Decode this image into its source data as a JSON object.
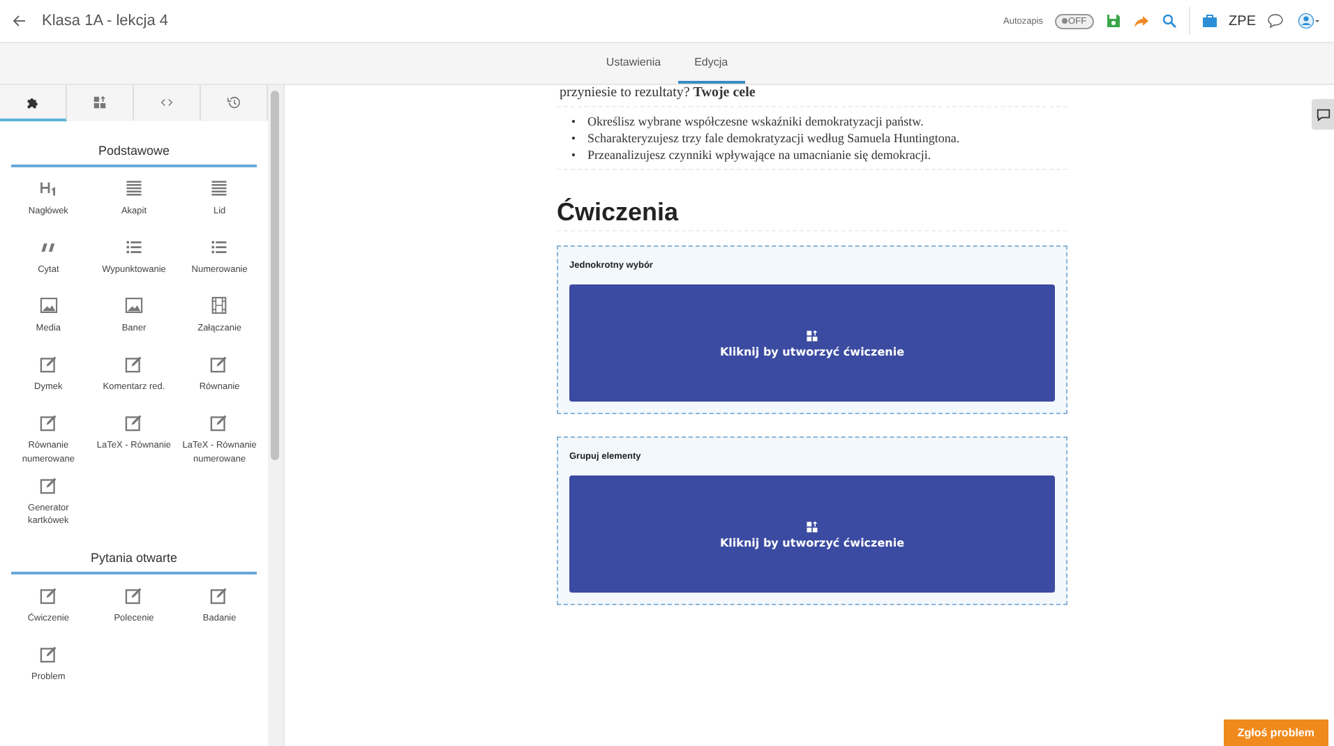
{
  "header": {
    "title": "Klasa 1A - lekcja 4",
    "autosave": {
      "label": "Autozapis",
      "toggle_text": "OFF",
      "on": false
    },
    "brand": "ZPE"
  },
  "mode_tabs": [
    {
      "label": "Ustawienia",
      "selected": false
    },
    {
      "label": "Edycja",
      "selected": true
    }
  ],
  "sidebar": {
    "tabs": [
      {
        "kind": "puzzle",
        "selected": true
      },
      {
        "kind": "grid",
        "selected": false
      },
      {
        "kind": "code",
        "selected": false
      },
      {
        "kind": "history",
        "selected": false
      }
    ],
    "sections": [
      {
        "title": "Podstawowe",
        "items": [
          {
            "label": "Nagłówek",
            "kind": "heading"
          },
          {
            "label": "Akapit",
            "kind": "lines"
          },
          {
            "label": "Lid",
            "kind": "lines"
          },
          {
            "label": "Cytat",
            "kind": "quote"
          },
          {
            "label": "Wypunktowanie",
            "kind": "list"
          },
          {
            "label": "Numerowanie",
            "kind": "list"
          },
          {
            "label": "Media",
            "kind": "image"
          },
          {
            "label": "Baner",
            "kind": "image"
          },
          {
            "label": "Załączanie",
            "kind": "film"
          },
          {
            "label": "Dymek",
            "kind": "edit"
          },
          {
            "label": "Komentarz red.",
            "kind": "edit"
          },
          {
            "label": "Równanie",
            "kind": "edit"
          },
          {
            "label": "Równanie numerowane",
            "kind": "edit"
          },
          {
            "label": "LaTeX - Równanie",
            "kind": "edit"
          },
          {
            "label": "LaTeX - Równanie numerowane",
            "kind": "edit"
          },
          {
            "label": "Generator kartkówek",
            "kind": "edit"
          }
        ]
      },
      {
        "title": "Pytania otwarte",
        "items": [
          {
            "label": "Ćwiczenie",
            "kind": "edit"
          },
          {
            "label": "Polecenie",
            "kind": "edit"
          },
          {
            "label": "Badanie",
            "kind": "edit"
          },
          {
            "label": "Problem",
            "kind": "edit"
          }
        ]
      }
    ]
  },
  "document": {
    "intro": "przyniesie to rezultaty? **Twoje cele**",
    "goals": [
      {
        "marker": "•",
        "text": "Określisz wybrane współczesne wskaźniki demokratyzacji państw."
      },
      {
        "marker": "•",
        "text": "Scharakteryzujesz trzy fale demokratyzacji według Samuela Huntingtona."
      },
      {
        "marker": "•",
        "text": "Przeanalizujesz czynniki wpływające na umacnianie się demokracji."
      }
    ],
    "heading": "Ćwiczenia",
    "exercises": [
      {
        "title": "Jednokrotny wybór",
        "button": "Kliknij by utworzyć ćwiczenie"
      },
      {
        "title": "Grupuj elementy",
        "button": "Kliknij by utworzyć ćwiczenie"
      }
    ]
  },
  "report_button": "Zgłoś problem"
}
